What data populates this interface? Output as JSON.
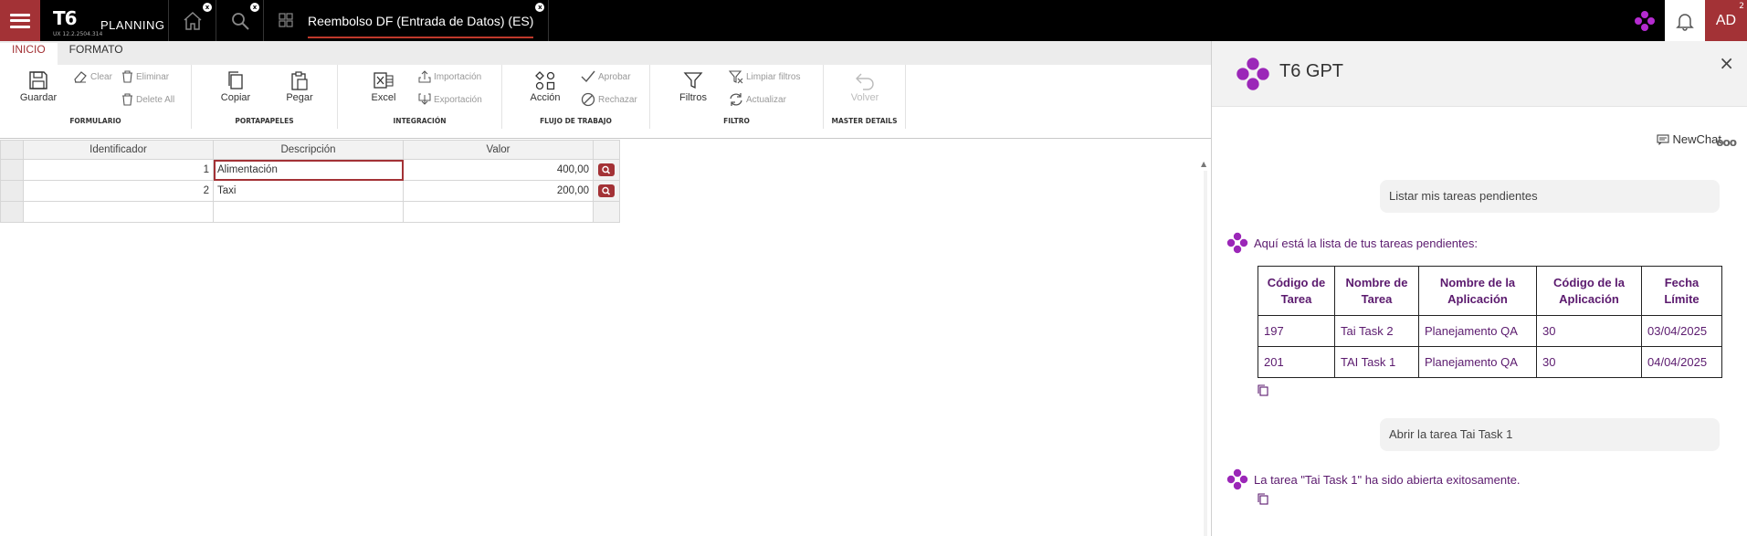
{
  "topbar": {
    "app_name": "T6 PLANNING",
    "logo_mark": "T6",
    "logo_word": "PLANNING",
    "version": "UX 12.2.2504.314",
    "close_glyph": "x",
    "active_tab_title": "Reembolso DF (Entrada de Datos) (ES)",
    "user_initials": "AD",
    "notification_count": "2",
    "accent_color": "#a33236"
  },
  "ribbon": {
    "tabs": [
      "INICIO",
      "FORMATO"
    ],
    "groups": {
      "formulario": {
        "label": "FORMULARIO",
        "guardar": "Guardar",
        "clear": "Clear",
        "eliminar": "Eliminar",
        "delete_all": "Delete All"
      },
      "portapapeles": {
        "label": "PORTAPAPELES",
        "copiar": "Copiar",
        "pegar": "Pegar"
      },
      "integracion": {
        "label": "INTEGRACIÓN",
        "excel": "Excel",
        "importacion": "Importación",
        "exportacion": "Exportación"
      },
      "flujo": {
        "label": "FLUJO DE TRABAJO",
        "accion": "Acción",
        "aprobar": "Aprobar",
        "rechazar": "Rechazar"
      },
      "filtro": {
        "label": "FILTRO",
        "filtros": "Filtros",
        "limpiar": "Limpiar filtros",
        "actualizar": "Actualizar"
      },
      "master": {
        "label": "MASTER DETAILS",
        "volver": "Volver"
      }
    }
  },
  "grid": {
    "columns": [
      "Identificador",
      "Descripción",
      "Valor"
    ],
    "rows": [
      {
        "id": "1",
        "descripcion": "Alimentación",
        "valor": "400,00"
      },
      {
        "id": "2",
        "descripcion": "Taxi",
        "valor": "200,00"
      }
    ]
  },
  "gpt": {
    "title": "T6 GPT",
    "new_chat": "NewChat",
    "more": "ooo",
    "close": "×",
    "messages": {
      "user1": "Listar mis tareas pendientes",
      "bot1": "Aquí está la lista de tus tareas pendientes:",
      "user2": "Abrir la tarea Tai Task 1",
      "bot2": "La tarea \"Tai Task 1\" ha sido abierta exitosamente."
    },
    "table": {
      "headers": [
        "Código de Tarea",
        "Nombre de Tarea",
        "Nombre de la Aplicación",
        "Código de la Aplicación",
        "Fecha Límite"
      ],
      "rows": [
        [
          "197",
          "Tai Task 2",
          "Planejamento QA",
          "30",
          "03/04/2025"
        ],
        [
          "201",
          "TAI Task 1",
          "Planejamento QA",
          "30",
          "04/04/2025"
        ]
      ]
    },
    "brand_color": "#8e1fa8",
    "text_color": "#5b1a6e"
  }
}
